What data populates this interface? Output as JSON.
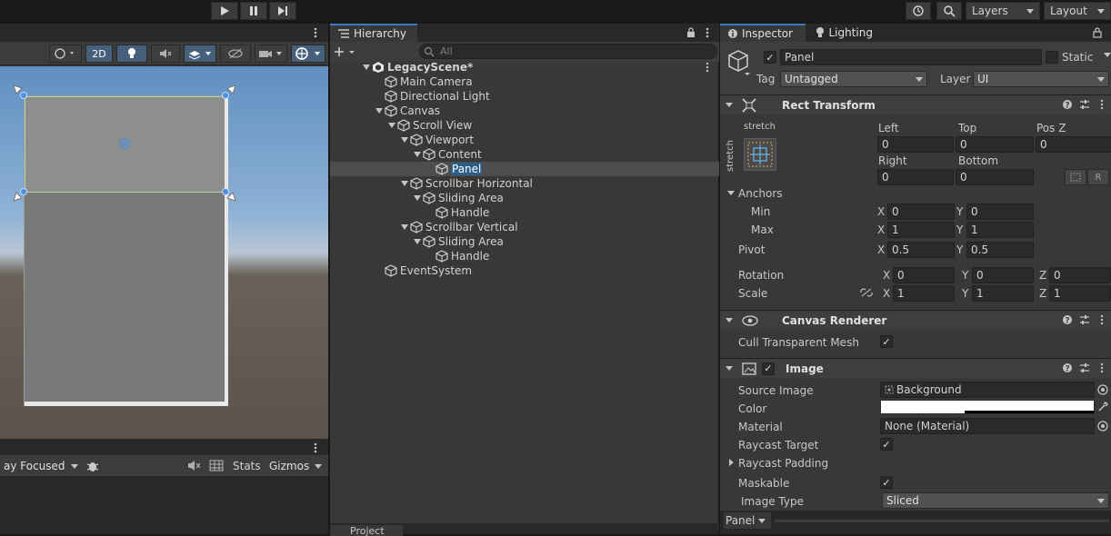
{
  "toolbar": {
    "layers": "Layers",
    "layout": "Layout"
  },
  "scene_toolbar": {
    "mode_2d": "2D"
  },
  "game_toolbar": {
    "focused": "ay Focused",
    "stats": "Stats",
    "gizmos": "Gizmos"
  },
  "hierarchy": {
    "tab": "Hierarchy",
    "search_placeholder": "All",
    "items": [
      {
        "label": "LegacyScene*",
        "depth": 0,
        "expander": true,
        "icon": "unity-scene-icon"
      },
      {
        "label": "Main Camera",
        "depth": 1,
        "expander": false,
        "icon": "gameobject-icon"
      },
      {
        "label": "Directional Light",
        "depth": 1,
        "expander": false,
        "icon": "gameobject-icon"
      },
      {
        "label": "Canvas",
        "depth": 1,
        "expander": true,
        "icon": "gameobject-icon"
      },
      {
        "label": "Scroll View",
        "depth": 2,
        "expander": true,
        "icon": "gameobject-icon"
      },
      {
        "label": "Viewport",
        "depth": 3,
        "expander": true,
        "icon": "gameobject-icon"
      },
      {
        "label": "Content",
        "depth": 4,
        "expander": true,
        "icon": "gameobject-icon"
      },
      {
        "label": "Panel",
        "depth": 5,
        "expander": false,
        "icon": "gameobject-icon",
        "selected": true
      },
      {
        "label": "Scrollbar Horizontal",
        "depth": 3,
        "expander": true,
        "icon": "gameobject-icon"
      },
      {
        "label": "Sliding Area",
        "depth": 4,
        "expander": true,
        "icon": "gameobject-icon"
      },
      {
        "label": "Handle",
        "depth": 5,
        "expander": false,
        "icon": "gameobject-icon"
      },
      {
        "label": "Scrollbar Vertical",
        "depth": 3,
        "expander": true,
        "icon": "gameobject-icon"
      },
      {
        "label": "Sliding Area",
        "depth": 4,
        "expander": true,
        "icon": "gameobject-icon"
      },
      {
        "label": "Handle",
        "depth": 5,
        "expander": false,
        "icon": "gameobject-icon"
      },
      {
        "label": "EventSystem",
        "depth": 1,
        "expander": false,
        "icon": "gameobject-icon"
      }
    ],
    "project_tab": "Project"
  },
  "inspector": {
    "tab": "Inspector",
    "lighting_tab": "Lighting",
    "object_name": "Panel",
    "static_label": "Static",
    "tag_label": "Tag",
    "tag_value": "Untagged",
    "layer_label": "Layer",
    "layer_value": "UI",
    "rect": {
      "title": "Rect Transform",
      "anchor_preset_top": "stretch",
      "anchor_preset_side": "stretch",
      "left_label": "Left",
      "left": "0",
      "top_label": "Top",
      "top": "0",
      "posz_label": "Pos Z",
      "posz": "0",
      "right_label": "Right",
      "right": "0",
      "bottom_label": "Bottom",
      "bottom": "0",
      "r_button": "R",
      "anchors_label": "Anchors",
      "min_label": "Min",
      "min_x": "0",
      "min_y": "0",
      "max_label": "Max",
      "max_x": "1",
      "max_y": "1",
      "pivot_label": "Pivot",
      "pivot_x": "0.5",
      "pivot_y": "0.5",
      "rotation_label": "Rotation",
      "rot_x": "0",
      "rot_y": "0",
      "rot_z": "0",
      "scale_label": "Scale",
      "scale_x": "1",
      "scale_y": "1",
      "scale_z": "1",
      "x": "X",
      "y": "Y",
      "z": "Z"
    },
    "canvas_renderer": {
      "title": "Canvas Renderer",
      "cull_label": "Cull Transparent Mesh"
    },
    "image": {
      "title": "Image",
      "source_label": "Source Image",
      "source_value": "Background",
      "color_label": "Color",
      "material_label": "Material",
      "material_value": "None (Material)",
      "raycast_target_label": "Raycast Target",
      "raycast_padding_label": "Raycast Padding",
      "maskable_label": "Maskable",
      "image_type_label": "Image Type",
      "image_type_value": "Sliced"
    },
    "footer": {
      "label": "Panel"
    }
  }
}
